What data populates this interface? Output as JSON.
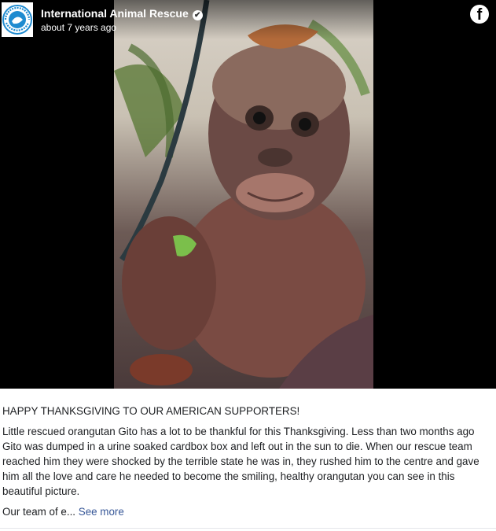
{
  "post": {
    "page_name": "International Animal Rescue",
    "timestamp": "about 7 years ago",
    "avatar_text": "INTERNATIONAL ANIMAL RESCUE",
    "headline": "HAPPY THANKSGIVING TO OUR AMERICAN SUPPORTERS!",
    "body": "Little rescued orangutan Gito has a lot to be thankful for this Thanksgiving. Less than two months ago Gito was dumped in a urine soaked cardbox box and left out in the sun to die. When our rescue team reached him they were shocked by the terrible state he was in, they rushed him to the centre and gave him all the love and care he needed to become the smiling, healthy orangutan you can see in this beautiful picture.",
    "truncated": "Our team of e...",
    "see_more": "See more"
  },
  "icons": {
    "verified": "verified-badge-icon",
    "facebook": "facebook-logo-icon"
  }
}
